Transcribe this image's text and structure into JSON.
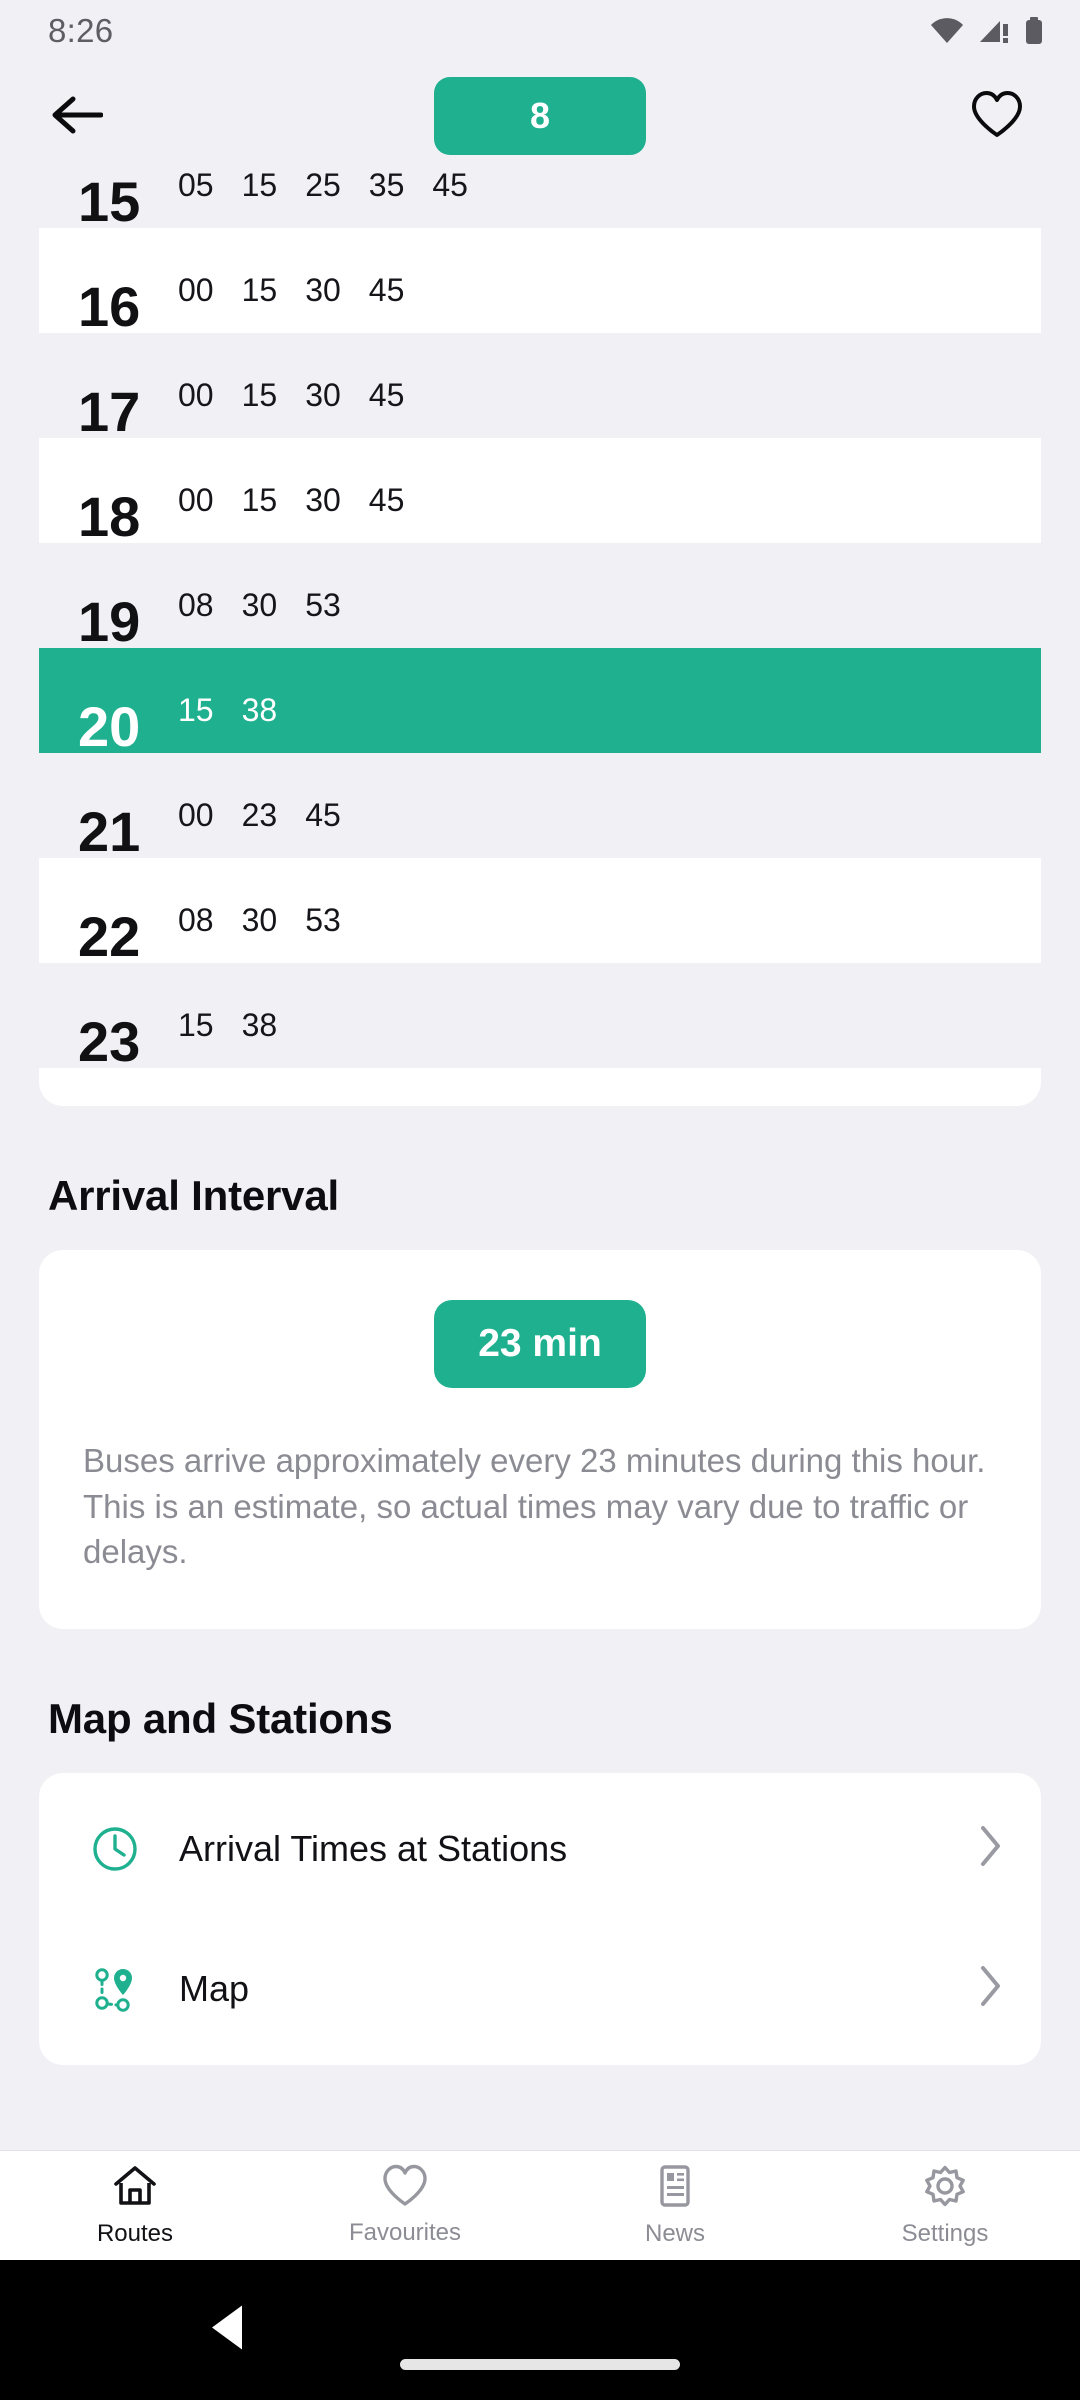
{
  "status_bar": {
    "time": "8:26",
    "icons": [
      "wifi-icon",
      "cellular-signal-icon",
      "battery-icon"
    ]
  },
  "app_bar": {
    "back_icon": "arrow-left-icon",
    "route_number": "8",
    "favourite_icon": "heart-outline-icon"
  },
  "timetable": {
    "rows": [
      {
        "hour": "15",
        "minutes": [
          "05",
          "15",
          "25",
          "35",
          "45"
        ],
        "active": false,
        "clipped": true
      },
      {
        "hour": "16",
        "minutes": [
          "00",
          "15",
          "30",
          "45"
        ],
        "active": false,
        "clipped": false
      },
      {
        "hour": "17",
        "minutes": [
          "00",
          "15",
          "30",
          "45"
        ],
        "active": false,
        "clipped": false
      },
      {
        "hour": "18",
        "minutes": [
          "00",
          "15",
          "30",
          "45"
        ],
        "active": false,
        "clipped": false
      },
      {
        "hour": "19",
        "minutes": [
          "08",
          "30",
          "53"
        ],
        "active": false,
        "clipped": false
      },
      {
        "hour": "20",
        "minutes": [
          "15",
          "38"
        ],
        "active": true,
        "clipped": false
      },
      {
        "hour": "21",
        "minutes": [
          "00",
          "23",
          "45"
        ],
        "active": false,
        "clipped": false
      },
      {
        "hour": "22",
        "minutes": [
          "08",
          "30",
          "53"
        ],
        "active": false,
        "clipped": false
      },
      {
        "hour": "23",
        "minutes": [
          "15",
          "38"
        ],
        "active": false,
        "clipped": false
      }
    ]
  },
  "arrival_interval": {
    "heading": "Arrival Interval",
    "value": "23 min",
    "description": "Buses arrive approximately every 23 minutes during this hour. This is an estimate, so actual times may vary due to traffic or delays."
  },
  "map_and_stations": {
    "heading": "Map and Stations",
    "items": [
      {
        "label": "Arrival Times at Stations",
        "icon": "clock-icon"
      },
      {
        "label": "Map",
        "icon": "route-pins-icon"
      }
    ]
  },
  "bottom_nav": {
    "items": [
      {
        "label": "Routes",
        "icon": "home-icon",
        "active": true
      },
      {
        "label": "Favourites",
        "icon": "heart-icon",
        "active": false
      },
      {
        "label": "News",
        "icon": "news-icon",
        "active": false
      },
      {
        "label": "Settings",
        "icon": "gear-icon",
        "active": false
      }
    ]
  },
  "android_nav": {
    "back_icon": "triangle-back-icon",
    "home_indicator": "home-pill"
  },
  "colors": {
    "accent": "#1fb18f",
    "background": "#f1f1f5",
    "card": "#ffffff",
    "row_alt": "#f1f1f5",
    "muted_text": "#8b8b93"
  }
}
